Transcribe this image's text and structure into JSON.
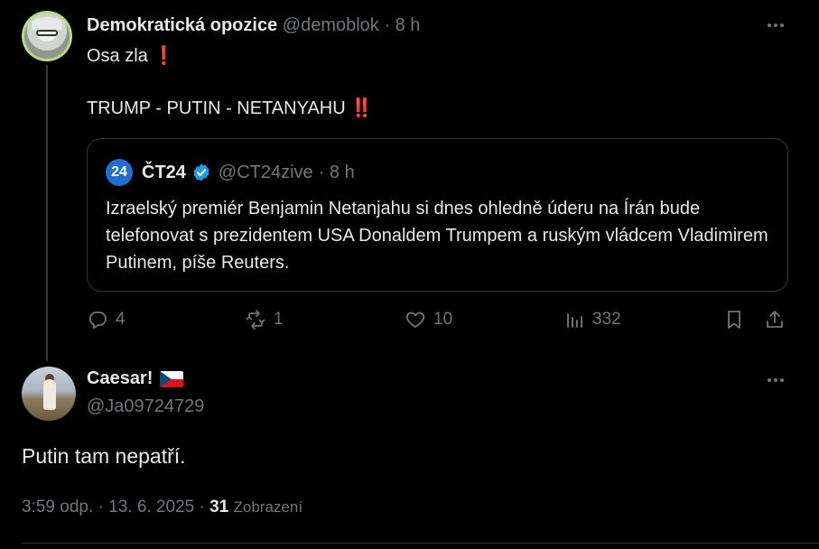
{
  "parent_tweet": {
    "display_name": "Demokratická opozice",
    "handle": "@demoblok",
    "time": "· 8 h",
    "line1": "Osa zla",
    "line1_emoji": "❗",
    "line2": "TRUMP - PUTIN - NETANYAHU",
    "line2_emoji": "‼️",
    "quote": {
      "logo_text": "24",
      "display_name": "ČT24",
      "handle": "@CT24zive",
      "time": "· 8 h",
      "text": "Izraelský premiér Benjamin Netanjahu si dnes ohledně úderu na Írán bude telefonovat s prezidentem USA Donaldem Trumpem a ruským vládcem Vladimirem Putinem, píše Reuters."
    },
    "actions": {
      "replies": "4",
      "reposts": "1",
      "likes": "10",
      "views": "332"
    }
  },
  "reply_tweet": {
    "display_name": "Caesar!",
    "handle": "@Ja09724729",
    "text": "Putin tam nepatří.",
    "timestamp": "3:59 odp. · 13. 6. 2025 ·",
    "views_count": "31",
    "views_label": "Zobrazení"
  },
  "colors": {
    "background": "#000000",
    "text": "#e7e9ea",
    "muted": "#71767b",
    "verified": "#1d9bf0",
    "ct24_blue": "#1f6fd1",
    "emoji_red": "#e0245e"
  }
}
